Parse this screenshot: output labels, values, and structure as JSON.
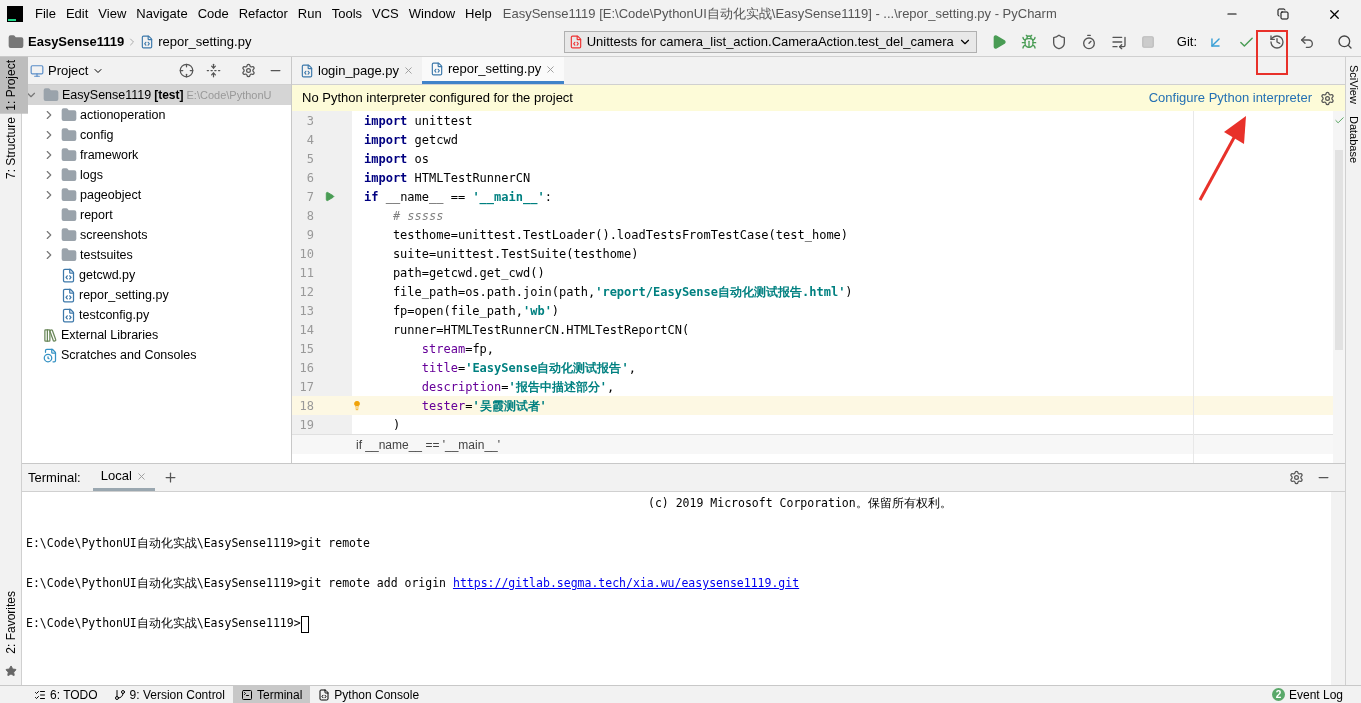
{
  "window": {
    "title": "EasySense1119 [E:\\Code\\PythonUI自动化实战\\EasySense1119] - ...\\repor_setting.py - PyCharm"
  },
  "menu": [
    "File",
    "Edit",
    "View",
    "Navigate",
    "Code",
    "Refactor",
    "Run",
    "Tools",
    "VCS",
    "Window",
    "Help"
  ],
  "breadcrumb": [
    "EasySense1119",
    "repor_setting.py"
  ],
  "run_config": "Unittests for camera_list_action.CameraAction.test_del_camera",
  "git_label": "Git:",
  "left_strip": [
    {
      "label": "1: Project",
      "selected": true
    },
    {
      "label": "7: Structure",
      "selected": false
    }
  ],
  "left_strip_bottom": [
    {
      "label": "2: Favorites",
      "selected": false
    }
  ],
  "right_strip": [
    "SciView",
    "Database"
  ],
  "project_panel": {
    "title": "Project",
    "tree": [
      {
        "kind": "root",
        "label": "EasySense1119",
        "suffix": "[test]",
        "path": "E:\\Code\\PythonU",
        "expanded": true,
        "children": [
          {
            "kind": "folder",
            "label": "actionoperation",
            "expanded": false
          },
          {
            "kind": "folder",
            "label": "config",
            "expanded": false
          },
          {
            "kind": "folder",
            "label": "framework",
            "expanded": false
          },
          {
            "kind": "folder",
            "label": "logs",
            "expanded": false
          },
          {
            "kind": "folder",
            "label": "pageobject",
            "expanded": false
          },
          {
            "kind": "folder",
            "label": "report"
          },
          {
            "kind": "folder",
            "label": "screenshots",
            "expanded": false
          },
          {
            "kind": "folder",
            "label": "testsuites",
            "expanded": false
          },
          {
            "kind": "file",
            "label": "getcwd.py"
          },
          {
            "kind": "file",
            "label": "repor_setting.py"
          },
          {
            "kind": "file",
            "label": "testconfig.py"
          }
        ]
      },
      {
        "kind": "libraries",
        "label": "External Libraries"
      },
      {
        "kind": "scratches",
        "label": "Scratches and Consoles"
      }
    ]
  },
  "editor": {
    "tabs": [
      {
        "label": "login_page.py",
        "selected": false
      },
      {
        "label": "repor_setting.py",
        "selected": true
      }
    ],
    "banner": {
      "message": "No Python interpreter configured for the project",
      "action": "Configure Python interpreter"
    },
    "lines": [
      {
        "number": "3",
        "run": false,
        "current": false,
        "segments": [
          {
            "kind": "keyword",
            "text": "import"
          },
          {
            "kind": "plain",
            "text": " unittest"
          }
        ]
      },
      {
        "number": "4",
        "run": false,
        "current": false,
        "segments": [
          {
            "kind": "keyword",
            "text": "import"
          },
          {
            "kind": "plain",
            "text": " getcwd"
          }
        ]
      },
      {
        "number": "5",
        "run": false,
        "current": false,
        "segments": [
          {
            "kind": "keyword",
            "text": "import"
          },
          {
            "kind": "plain",
            "text": " os"
          }
        ]
      },
      {
        "number": "6",
        "run": false,
        "current": false,
        "segments": [
          {
            "kind": "keyword",
            "text": "import"
          },
          {
            "kind": "plain",
            "text": " HTMLTestRunnerCN"
          }
        ]
      },
      {
        "number": "7",
        "run": true,
        "current": false,
        "segments": [
          {
            "kind": "keyword",
            "text": "if"
          },
          {
            "kind": "plain",
            "text": " __name__ == "
          },
          {
            "kind": "string",
            "text": "'__main__'"
          },
          {
            "kind": "plain",
            "text": ":"
          }
        ]
      },
      {
        "number": "8",
        "run": false,
        "current": false,
        "segments": [
          {
            "kind": "comment",
            "text": "    # sssss"
          }
        ]
      },
      {
        "number": "9",
        "run": false,
        "current": false,
        "segments": [
          {
            "kind": "plain",
            "text": "    testhome=unittest.TestLoader().loadTestsFromTestCase(test_home)"
          }
        ]
      },
      {
        "number": "10",
        "run": false,
        "current": false,
        "segments": [
          {
            "kind": "plain",
            "text": "    suite=unittest.TestSuite(testhome)"
          }
        ]
      },
      {
        "number": "11",
        "run": false,
        "current": false,
        "segments": [
          {
            "kind": "plain",
            "text": "    path=getcwd.get_cwd()"
          }
        ]
      },
      {
        "number": "12",
        "run": false,
        "current": false,
        "segments": [
          {
            "kind": "plain",
            "text": "    file_path=os.path.join(path,"
          },
          {
            "kind": "string",
            "text": "'report/EasySense自动化测试报告.html'"
          },
          {
            "kind": "plain",
            "text": ")"
          }
        ]
      },
      {
        "number": "13",
        "run": false,
        "current": false,
        "segments": [
          {
            "kind": "plain",
            "text": "    fp=open(file_path,"
          },
          {
            "kind": "string",
            "text": "'wb'"
          },
          {
            "kind": "plain",
            "text": ")"
          }
        ]
      },
      {
        "number": "14",
        "run": false,
        "current": false,
        "segments": [
          {
            "kind": "plain",
            "text": "    runner=HTMLTestRunnerCN.HTMLTestReportCN("
          }
        ]
      },
      {
        "number": "15",
        "run": false,
        "current": false,
        "segments": [
          {
            "kind": "param",
            "text": "        stream"
          },
          {
            "kind": "plain",
            "text": "=fp,"
          }
        ]
      },
      {
        "number": "16",
        "run": false,
        "current": false,
        "segments": [
          {
            "kind": "param",
            "text": "        title"
          },
          {
            "kind": "plain",
            "text": "="
          },
          {
            "kind": "string",
            "text": "'EasySense自动化测试报告'"
          },
          {
            "kind": "plain",
            "text": ","
          }
        ]
      },
      {
        "number": "17",
        "run": false,
        "current": false,
        "segments": [
          {
            "kind": "param",
            "text": "        description"
          },
          {
            "kind": "plain",
            "text": "="
          },
          {
            "kind": "string",
            "text": "'报告中描述部分'"
          },
          {
            "kind": "plain",
            "text": ","
          }
        ]
      },
      {
        "number": "18",
        "run": false,
        "current": true,
        "segments": [
          {
            "kind": "param",
            "text": "        tester"
          },
          {
            "kind": "plain",
            "text": "="
          },
          {
            "kind": "string",
            "text": "'吴霞测试者'"
          }
        ]
      },
      {
        "number": "19",
        "run": false,
        "current": false,
        "segments": [
          {
            "kind": "plain",
            "text": "    )"
          }
        ]
      }
    ],
    "breadcrumb": "if __name__ == '__main__'"
  },
  "terminal": {
    "title": "Terminal:",
    "tabs": [
      {
        "label": "Local",
        "selected": true
      }
    ],
    "lines": [
      {
        "kind": "banner",
        "segments": [
          {
            "kind": "plain",
            "text": "(c) 2019 Microsoft Corporation。保留所有权利。"
          }
        ]
      },
      {
        "kind": "command",
        "segments": [
          {
            "kind": "plain",
            "text": "E:\\Code\\PythonUI自动化实战\\EasySense1119>git remote"
          }
        ]
      },
      {
        "kind": "command",
        "segments": [
          {
            "kind": "plain",
            "text": "E:\\Code\\PythonUI自动化实战\\EasySense1119>git remote add origin "
          },
          {
            "kind": "link",
            "text": "https://gitlab.segma.tech/xia.wu/easysense1119.git"
          }
        ]
      },
      {
        "kind": "prompt",
        "cursor": true,
        "segments": [
          {
            "kind": "plain",
            "text": "E:\\Code\\PythonUI自动化实战\\EasySense1119>"
          }
        ]
      }
    ]
  },
  "bottom_bar": {
    "tools": [
      {
        "label": "6: TODO",
        "selected": false
      },
      {
        "label": "9: Version Control",
        "selected": false
      },
      {
        "label": "Terminal",
        "selected": true
      },
      {
        "label": "Python Console",
        "selected": false
      }
    ],
    "event_log": {
      "count": "2",
      "label": "Event Log"
    }
  }
}
